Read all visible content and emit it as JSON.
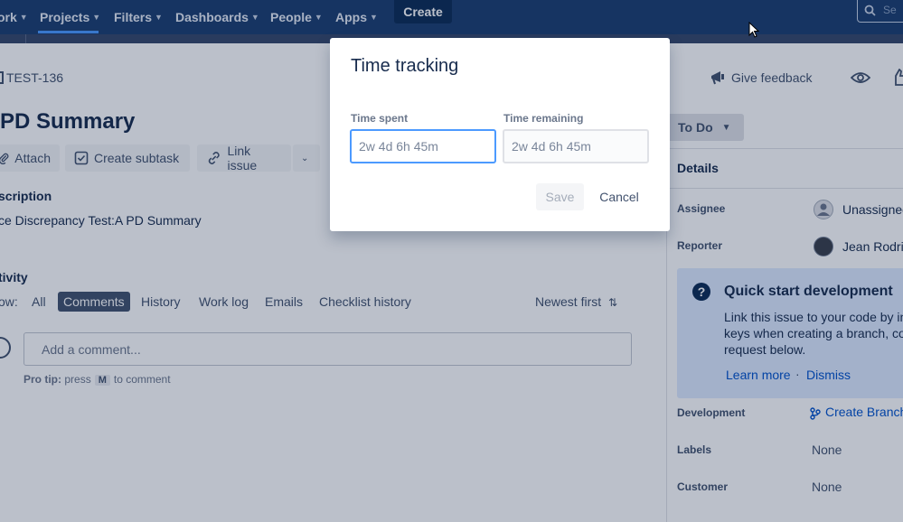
{
  "nav": {
    "items": [
      {
        "label": "ork"
      },
      {
        "label": "Projects"
      },
      {
        "label": "Filters"
      },
      {
        "label": "Dashboards"
      },
      {
        "label": "People"
      },
      {
        "label": "Apps"
      }
    ],
    "create_label": "Create",
    "search_placeholder": "Se"
  },
  "issue": {
    "key": "TEST-136",
    "title": "PD Summary",
    "toolbar": {
      "attach": "Attach",
      "create_subtask": "Create subtask",
      "link_issue": "Link issue"
    },
    "description_heading": "scription",
    "description_text": "ce Discrepancy Test:A PD Summary",
    "activity_heading": "tivity",
    "show_label": "ow:",
    "activity_tabs": [
      {
        "label": "All",
        "selected": false
      },
      {
        "label": "Comments",
        "selected": true
      },
      {
        "label": "History",
        "selected": false
      },
      {
        "label": "Work log",
        "selected": false
      },
      {
        "label": "Emails",
        "selected": false
      },
      {
        "label": "Checklist history",
        "selected": false
      }
    ],
    "sort_label": "Newest first",
    "comment_placeholder": "Add a comment...",
    "protip": {
      "prefix": "Pro tip:",
      "press": "press",
      "key": "M",
      "suffix": "to comment"
    }
  },
  "sidebar": {
    "feedback_label": "Give feedback",
    "status_label": "To Do",
    "details_heading": "Details",
    "fields": {
      "assignee_label": "Assignee",
      "assignee_value": "Unassigned",
      "reporter_label": "Reporter",
      "reporter_value": "Jean Rodrig",
      "development_label": "Development",
      "create_branch": "Create Branch",
      "labels_label": "Labels",
      "labels_value": "None",
      "customer_label": "Customer",
      "customer_value": "None"
    },
    "quick_start": {
      "title": "Quick start development",
      "body_line1": "Link this issue to your code by in",
      "body_line2": "keys when creating a branch, co",
      "body_line3": "request below.",
      "learn_more": "Learn more",
      "separator": "·",
      "dismiss": "Dismiss"
    }
  },
  "modal": {
    "title": "Time tracking",
    "time_spent_label": "Time spent",
    "time_spent_placeholder": "2w 4d 6h 45m",
    "time_remaining_label": "Time remaining",
    "time_remaining_placeholder": "2w 4d 6h 45m",
    "save_label": "Save",
    "cancel_label": "Cancel"
  },
  "colors": {
    "nav_bg": "#1b3e70",
    "accent": "#4c9aff",
    "link": "#0052cc"
  }
}
